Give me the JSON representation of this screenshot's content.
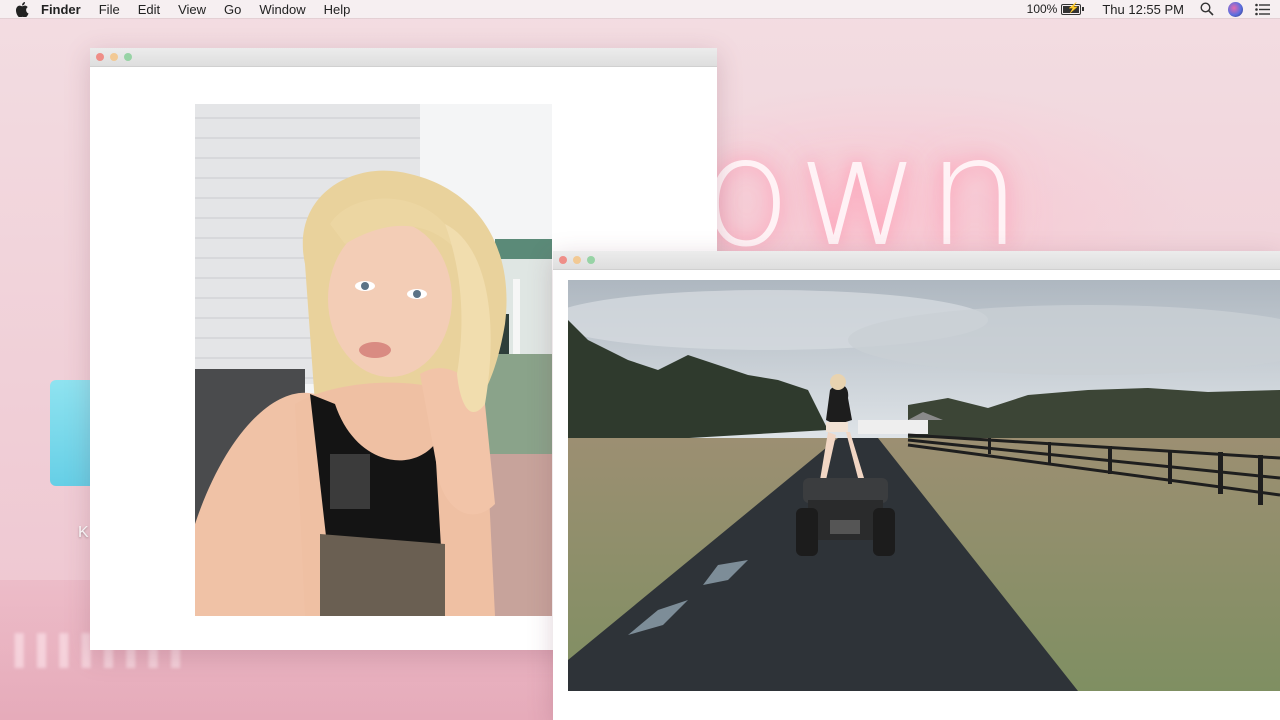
{
  "menubar": {
    "app_name": "Finder",
    "menus": [
      "File",
      "Edit",
      "View",
      "Go",
      "Window",
      "Help"
    ],
    "battery_percent": "100%",
    "clock": "Thu 12:55 PM",
    "icons": [
      "apple-logo",
      "battery-charging",
      "spotlight-search",
      "siri",
      "notification-center"
    ]
  },
  "desktop": {
    "neon_text": "own",
    "folder_label": "K"
  },
  "windows": [
    {
      "name": "selfie-photo-window",
      "image": "selfie of blonde woman by white house siding"
    },
    {
      "name": "atv-photo-window",
      "image": "woman standing on ATV on rural driveway with fence"
    }
  ],
  "colors": {
    "close": "#ef8e88",
    "minimize": "#f2c994",
    "maximize": "#97d3a5",
    "wallpaper": "#f2d3da"
  }
}
